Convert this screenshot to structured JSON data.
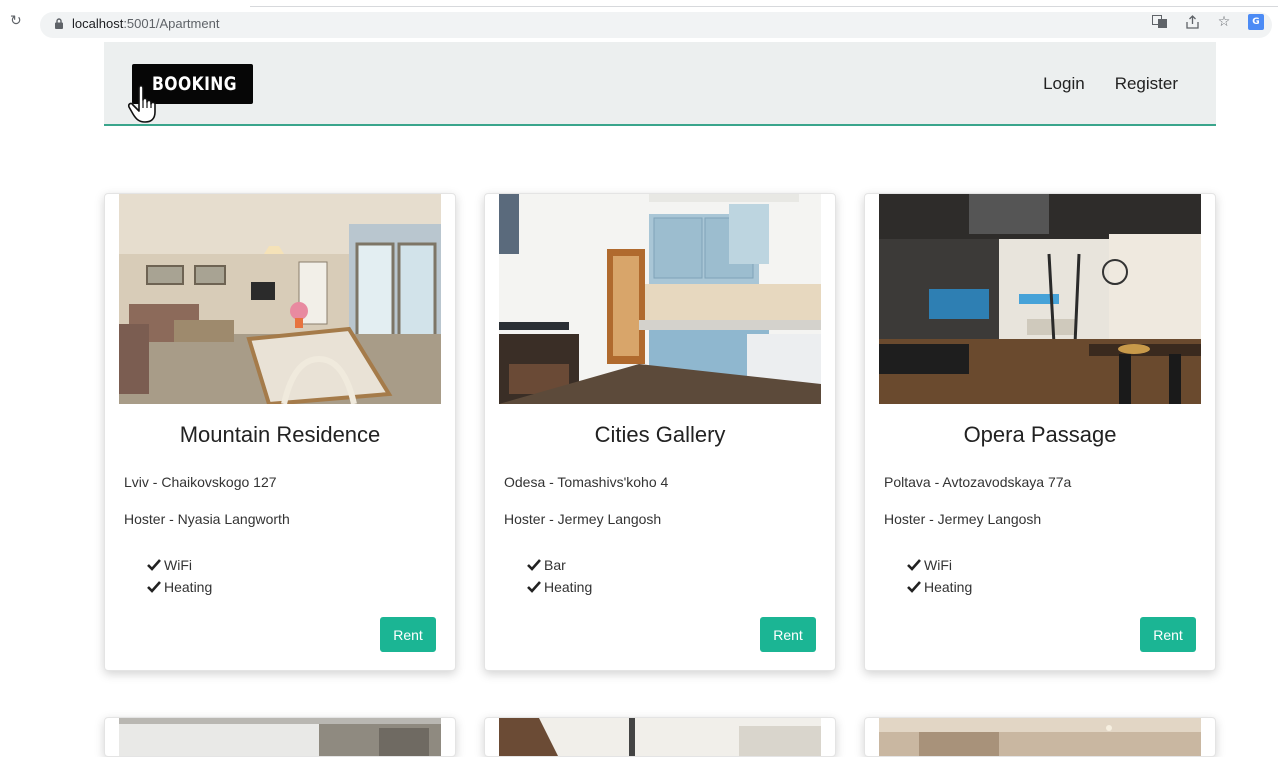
{
  "browser": {
    "url_host": "localhost",
    "url_rest": ":5001/Apartment",
    "icons": [
      "reload-icon",
      "lock-icon",
      "translate-icon",
      "share-icon",
      "star-icon",
      "extension-icon"
    ]
  },
  "navbar": {
    "logo_text": "BOOKING",
    "login_label": "Login",
    "register_label": "Register",
    "accent_color": "#3aa58c"
  },
  "apartments": [
    {
      "name": "Mountain Residence",
      "address": "Lviv - Chaikovskogo 127",
      "hoster": "Hoster - Nyasia Langworth",
      "amenities": [
        "WiFi",
        "Heating"
      ],
      "action_label": "Rent"
    },
    {
      "name": "Cities Gallery",
      "address": "Odesa - Tomashivs'koho 4",
      "hoster": "Hoster - Jermey Langosh",
      "amenities": [
        "Bar",
        "Heating"
      ],
      "action_label": "Rent"
    },
    {
      "name": "Opera Passage",
      "address": "Poltava - Avtozavodskaya 77a",
      "hoster": "Hoster - Jermey Langosh",
      "amenities": [
        "WiFi",
        "Heating"
      ],
      "action_label": "Rent"
    }
  ],
  "colors": {
    "rent_button": "#1bb594",
    "navbar_bg": "#ecefef"
  }
}
